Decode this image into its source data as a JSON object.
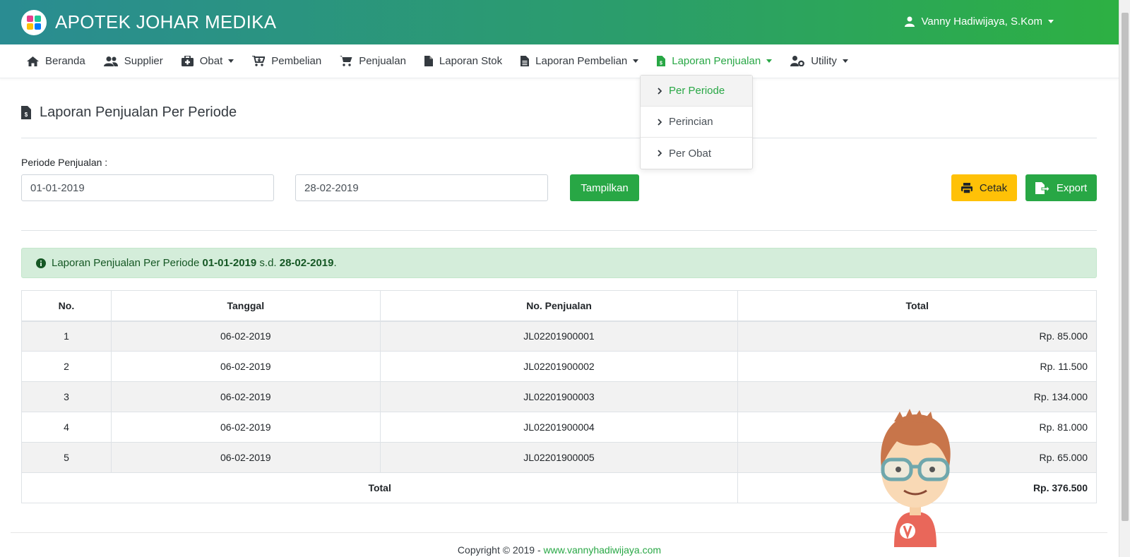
{
  "app": {
    "brand": "APOTEK JOHAR MEDIKA",
    "user": "Vanny Hadiwijaya, S.Kom"
  },
  "nav": [
    {
      "label": "Beranda",
      "icon": "home-icon"
    },
    {
      "label": "Supplier",
      "icon": "users-icon"
    },
    {
      "label": "Obat",
      "icon": "medkit-icon",
      "dropdown": true
    },
    {
      "label": "Pembelian",
      "icon": "cart-arrow-icon"
    },
    {
      "label": "Penjualan",
      "icon": "cart-icon"
    },
    {
      "label": "Laporan Stok",
      "icon": "file-icon"
    },
    {
      "label": "Laporan Pembelian",
      "icon": "file-alt-icon",
      "dropdown": true
    },
    {
      "label": "Laporan Penjualan",
      "icon": "file-invoice-icon",
      "dropdown": true,
      "active": true
    },
    {
      "label": "Utility",
      "icon": "user-cog-icon",
      "dropdown": true
    }
  ],
  "dropdown": {
    "items": [
      "Per Periode",
      "Perincian",
      "Per Obat"
    ]
  },
  "page": {
    "title": "Laporan Penjualan Per Periode",
    "filter_label": "Periode Penjualan :",
    "start_date": "01-01-2019",
    "end_date": "28-02-2019",
    "show_button": "Tampilkan",
    "print_button": "Cetak",
    "export_button": "Export"
  },
  "alert": {
    "prefix": "Laporan Penjualan Per Periode ",
    "start": "01-01-2019",
    "mid": " s.d. ",
    "end": "28-02-2019",
    "suffix": "."
  },
  "table": {
    "headers": [
      "No.",
      "Tanggal",
      "No. Penjualan",
      "Total"
    ],
    "rows": [
      [
        "1",
        "06-02-2019",
        "JL02201900001",
        "Rp. 85.000"
      ],
      [
        "2",
        "06-02-2019",
        "JL02201900002",
        "Rp. 11.500"
      ],
      [
        "3",
        "06-02-2019",
        "JL02201900003",
        "Rp. 134.000"
      ],
      [
        "4",
        "06-02-2019",
        "JL02201900004",
        "Rp. 81.000"
      ],
      [
        "5",
        "06-02-2019",
        "JL02201900005",
        "Rp. 65.000"
      ]
    ],
    "footer_label": "Total",
    "footer_value": "Rp. 376.500"
  },
  "footer": {
    "text": "Copyright © 2019 - ",
    "link": "www.vannyhadiwijaya.com"
  },
  "colors": {
    "accent": "#28a745",
    "warning": "#ffc107",
    "alert_bg": "#d4edda",
    "logo": [
      "#e83e8c",
      "#20c997",
      "#ffc107",
      "#007bff"
    ]
  }
}
